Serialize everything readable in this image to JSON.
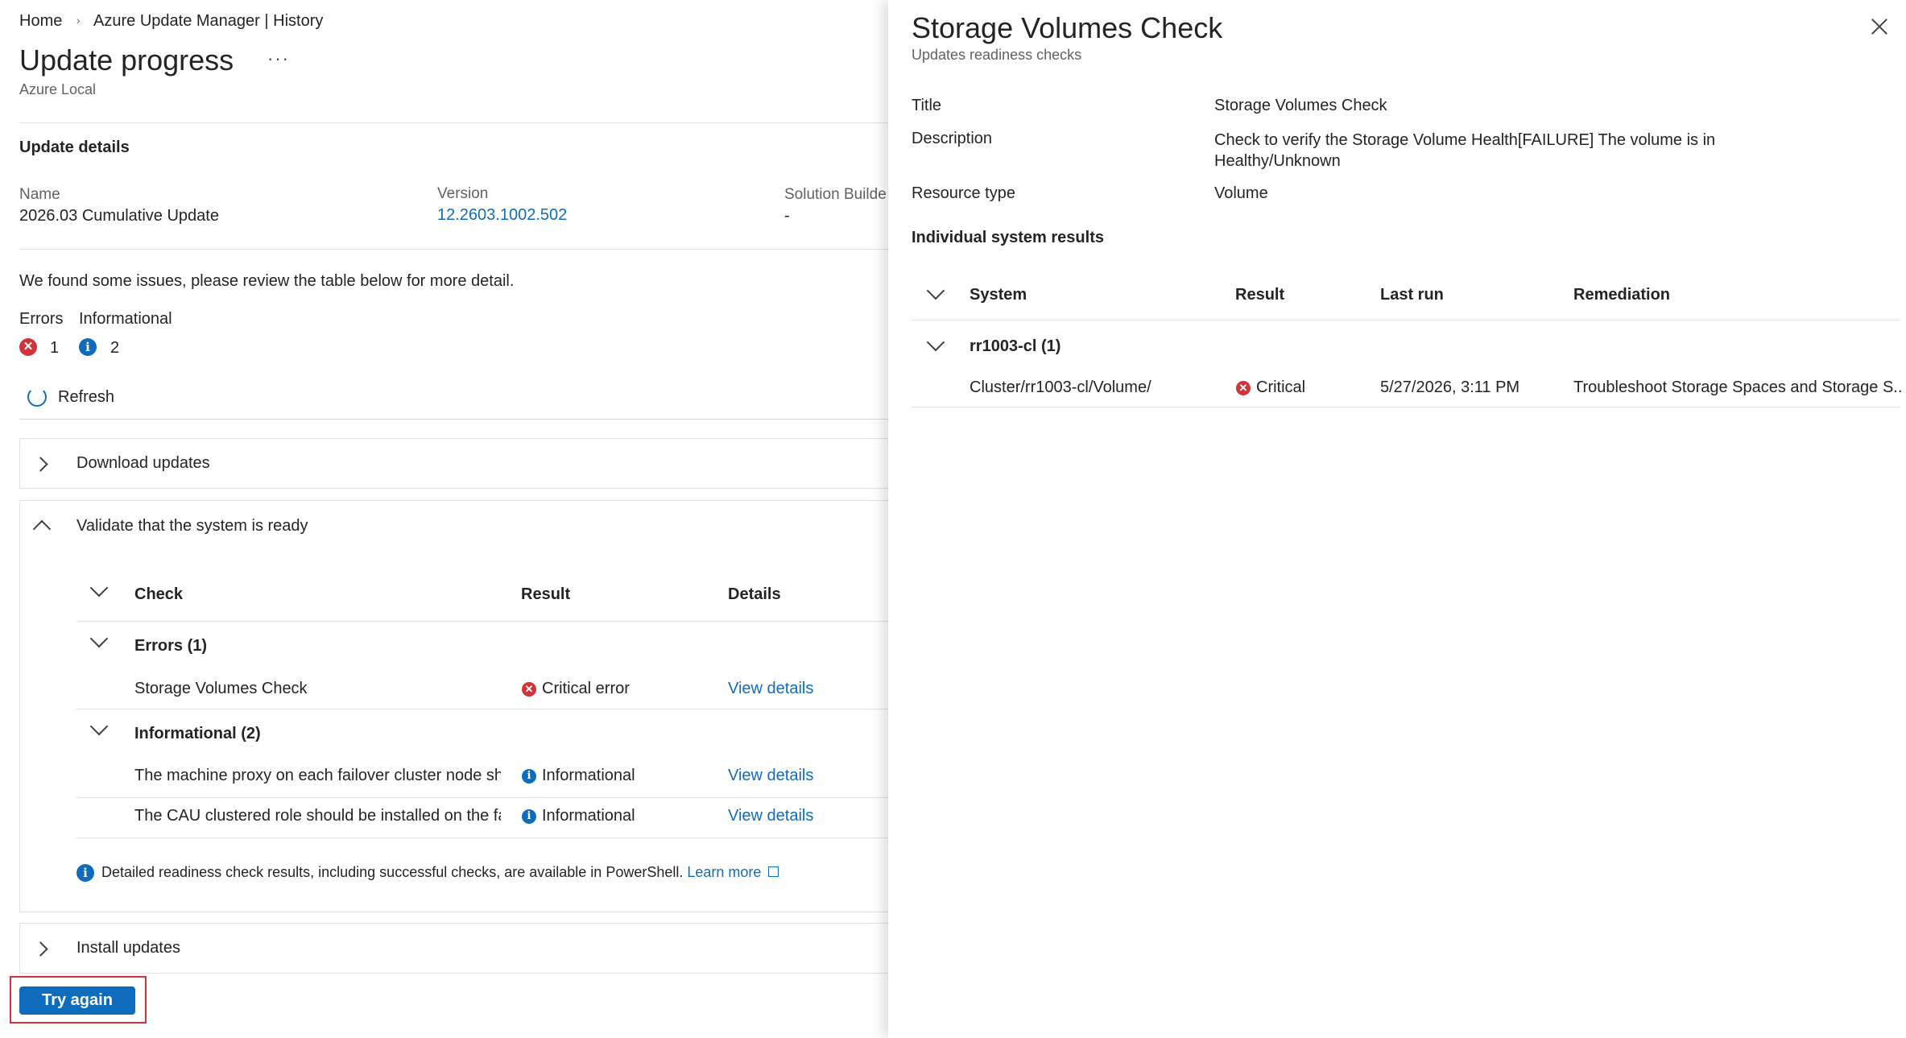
{
  "breadcrumb": {
    "home": "Home",
    "current": "Azure Update Manager | History"
  },
  "page": {
    "title": "Update progress",
    "subtitle": "Azure Local",
    "more": "···"
  },
  "update_details": {
    "heading": "Update details",
    "name_label": "Name",
    "name_value": "2026.03 Cumulative Update",
    "version_label": "Version",
    "version_value": "12.2603.1002.502",
    "solution_label": "Solution Builde",
    "solution_value": "-"
  },
  "issues": {
    "message": "We found some issues, please review the table below for more detail.",
    "errors_label": "Errors",
    "errors_count": "1",
    "info_label": "Informational",
    "info_count": "2"
  },
  "toolbar": {
    "refresh_label": "Refresh"
  },
  "steps": {
    "download": "Download updates",
    "validate": "Validate that the system is ready",
    "install": "Install updates"
  },
  "checks_table": {
    "headers": {
      "check": "Check",
      "result": "Result",
      "details": "Details"
    },
    "errors_group": "Errors (1)",
    "info_group": "Informational (2)",
    "rows": [
      {
        "check": "Storage Volumes Check",
        "result": "Critical error",
        "details": "View details"
      },
      {
        "check": "The machine proxy on each failover cluster node shou",
        "result": "Informational",
        "details": "View details"
      },
      {
        "check": "The CAU clustered role should be installed on the failc",
        "result": "Informational",
        "details": "View details"
      }
    ],
    "note": "Detailed readiness check results, including successful checks, are available in PowerShell.",
    "learn_more": "Learn more"
  },
  "actions": {
    "try_again": "Try again"
  },
  "panel": {
    "title": "Storage Volumes Check",
    "subtitle": "Updates readiness checks",
    "props": {
      "title_label": "Title",
      "title_value": "Storage Volumes Check",
      "description_label": "Description",
      "description_line1": "Check to verify the Storage Volume Health[FAILURE] The volume is in",
      "description_line2": "Healthy/Unknown",
      "resource_label": "Resource type",
      "resource_value": "Volume"
    },
    "results_heading": "Individual system results",
    "results_table": {
      "headers": {
        "system": "System",
        "result": "Result",
        "last_run": "Last run",
        "remediation": "Remediation"
      },
      "group": "rr1003-cl (1)",
      "row": {
        "system": "Cluster/rr1003-cl/Volume/",
        "result": "Critical",
        "last_run": "5/27/2026, 3:11 PM",
        "remediation": "Troubleshoot Storage Spaces and Storage S..."
      }
    }
  },
  "colors": {
    "accent": "#0f6cbd",
    "error": "#d13438",
    "highlight_border": "#d13438"
  }
}
